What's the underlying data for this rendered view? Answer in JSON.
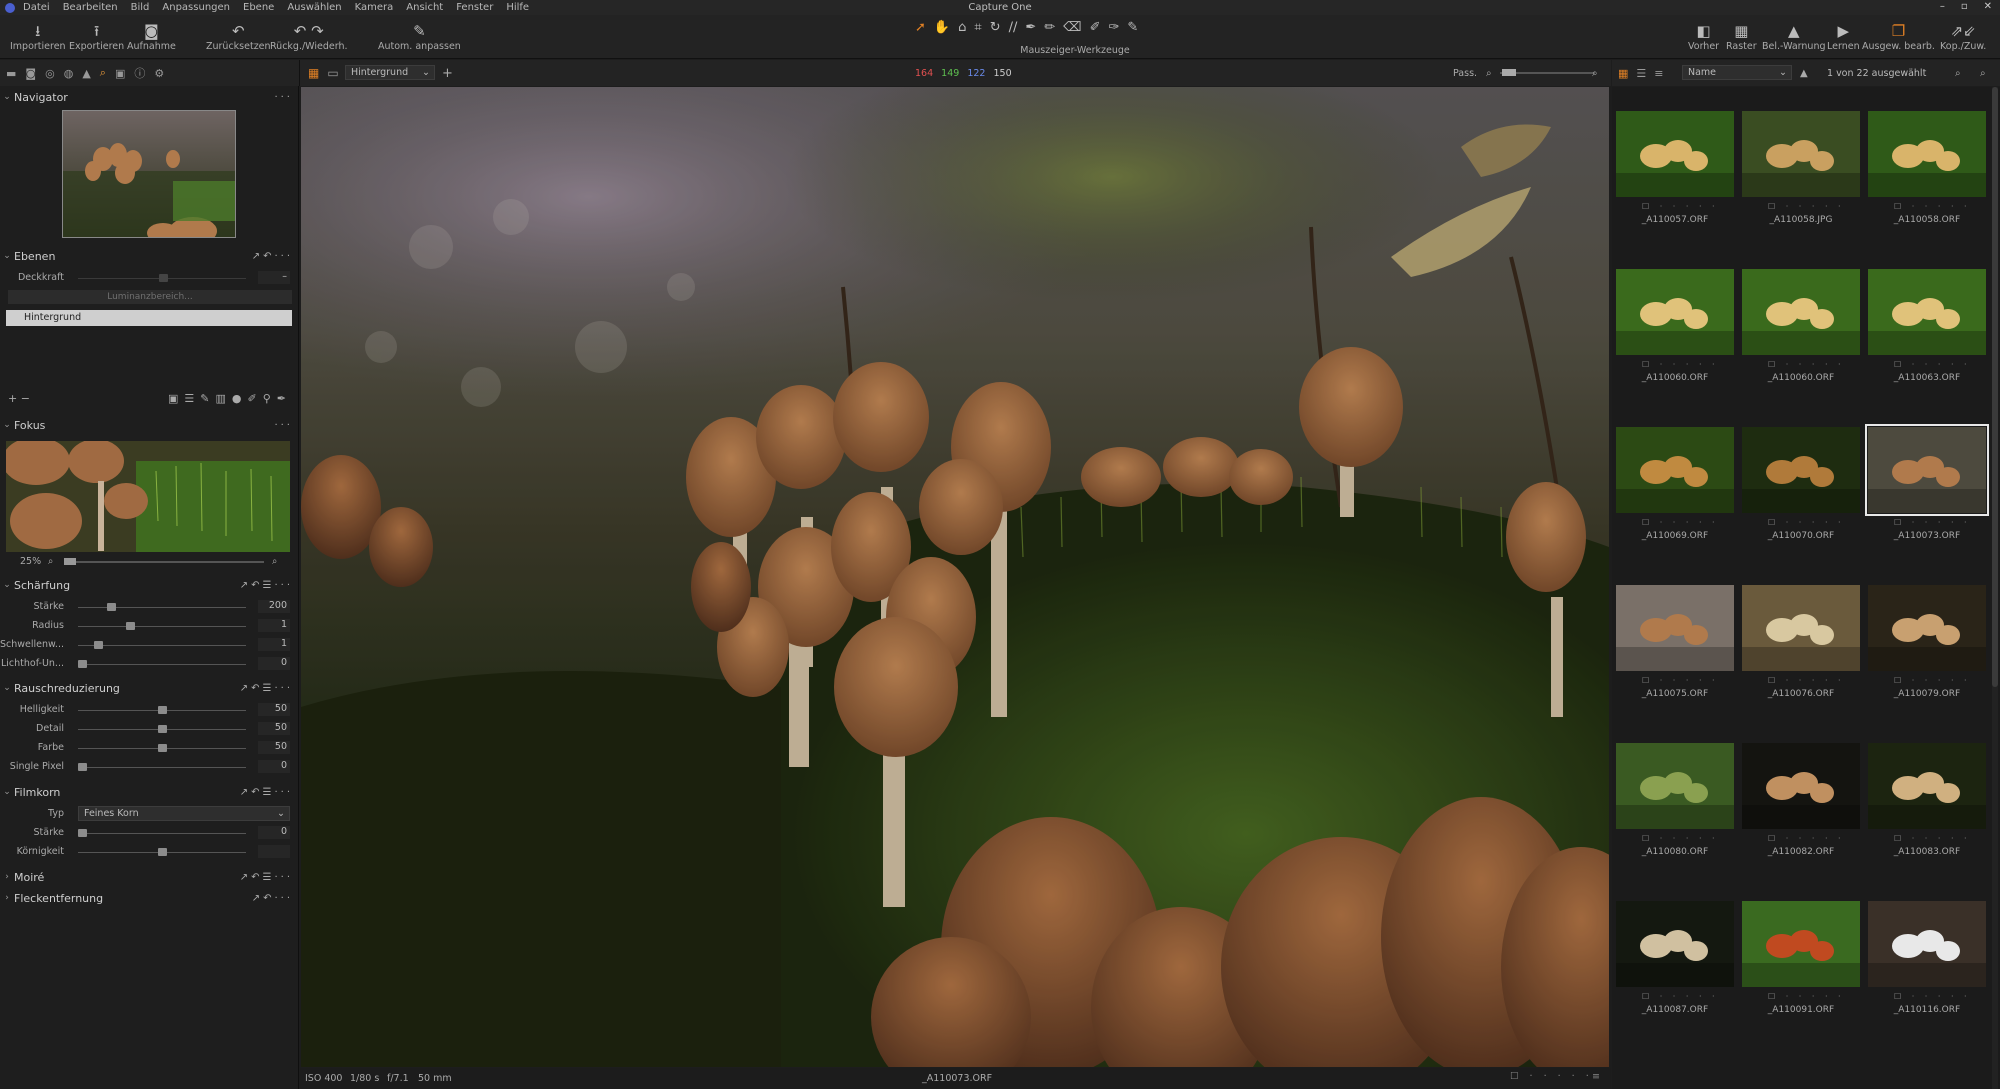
{
  "menu": {
    "items": [
      "Datei",
      "Bearbeiten",
      "Bild",
      "Anpassungen",
      "Ebene",
      "Auswählen",
      "Kamera",
      "Ansicht",
      "Fenster",
      "Hilfe"
    ],
    "app_title": "Capture One"
  },
  "toolbar": {
    "left": [
      {
        "label": "Importieren",
        "icon": "import-icon"
      },
      {
        "label": "Exportieren",
        "icon": "export-icon"
      },
      {
        "label": "Aufnahme",
        "icon": "camera-icon"
      }
    ],
    "undo": [
      {
        "label": "Zurücksetzen",
        "icon": "reset-icon"
      },
      {
        "label": "Rückg./Wiederh.",
        "icon": "undo-redo-icon"
      }
    ],
    "auto": {
      "label": "Autom. anpassen",
      "icon": "auto-adjust-icon"
    },
    "cursor_tools_label": "Mauszeiger-Werkzeuge",
    "right": [
      {
        "label": "Vorher",
        "icon": "before-icon"
      },
      {
        "label": "Raster",
        "icon": "grid-icon"
      },
      {
        "label": "Bel.-Warnung",
        "icon": "exposure-warning-icon"
      },
      {
        "label": "Lernen",
        "icon": "learn-icon"
      },
      {
        "label": "Ausgew. bearb.",
        "icon": "edit-selected-icon"
      },
      {
        "label": "Kop./Zuw.",
        "icon": "copy-apply-icon"
      }
    ]
  },
  "viewer_bar": {
    "layer_select": "Hintergrund",
    "rgb": {
      "r": "164",
      "g": "149",
      "b": "122",
      "l": "150"
    },
    "fit_label": "Pass."
  },
  "browser_bar": {
    "sort": "Name",
    "count": "1 von 22 ausgewählt"
  },
  "panels": {
    "navigator": {
      "title": "Navigator"
    },
    "layers": {
      "title": "Ebenen",
      "opacity_label": "Deckkraft",
      "luminance": "Luminanzbereich...",
      "background": "Hintergrund"
    },
    "focus": {
      "title": "Fokus",
      "zoom": "25%"
    },
    "sharpening": {
      "title": "Schärfung",
      "rows": [
        {
          "label": "Stärke",
          "value": "200",
          "pos": 0.18
        },
        {
          "label": "Radius",
          "value": "1",
          "pos": 0.3
        },
        {
          "label": "Schwellenw...",
          "value": "1",
          "pos": 0.1
        },
        {
          "label": "Lichthof-Un...",
          "value": "0",
          "pos": 0.0
        }
      ]
    },
    "noise": {
      "title": "Rauschreduzierung",
      "rows": [
        {
          "label": "Helligkeit",
          "value": "50",
          "pos": 0.5
        },
        {
          "label": "Detail",
          "value": "50",
          "pos": 0.5
        },
        {
          "label": "Farbe",
          "value": "50",
          "pos": 0.5
        },
        {
          "label": "Single Pixel",
          "value": "0",
          "pos": 0.0
        }
      ]
    },
    "grain": {
      "title": "Filmkorn",
      "type_label": "Typ",
      "type_value": "Feines Korn",
      "rows": [
        {
          "label": "Stärke",
          "value": "0",
          "pos": 0.0
        },
        {
          "label": "Körnigkeit",
          "value": "",
          "pos": 0.5
        }
      ]
    },
    "moire": {
      "title": "Moiré"
    },
    "spot": {
      "title": "Fleckentfernung"
    }
  },
  "status": {
    "iso": "ISO 400",
    "shutter": "1/80 s",
    "aperture": "f/7.1",
    "focal": "50 mm",
    "filename": "_A110073.ORF"
  },
  "thumbnails": [
    "_A110057.ORF",
    "_A110058.JPG",
    "_A110058.ORF",
    "_A110060.ORF",
    "_A110060.ORF",
    "_A110063.ORF",
    "_A110069.ORF",
    "_A110070.ORF",
    "_A110073.ORF",
    "_A110075.ORF",
    "_A110076.ORF",
    "_A110079.ORF",
    "_A110080.ORF",
    "_A110082.ORF",
    "_A110083.ORF",
    "_A110087.ORF",
    "_A110091.ORF",
    "_A110116.ORF"
  ],
  "selected_index": 8,
  "colors": {
    "accent": "#e08024",
    "panel": "#1e1e1e",
    "toolbar": "#232323"
  }
}
